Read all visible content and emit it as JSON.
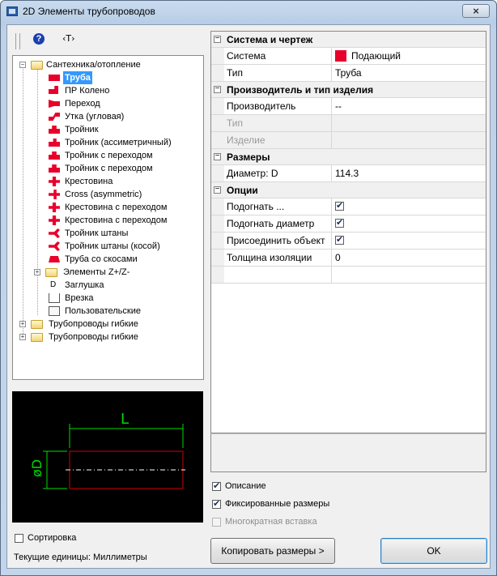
{
  "window": {
    "title": "2D Элементы трубопроводов",
    "close_glyph": "×"
  },
  "toolbar": {
    "help_glyph": "?",
    "t_glyph": "‹T›"
  },
  "tree": {
    "root": "Сантехника/отопление",
    "items": [
      "Труба",
      "ПР Колено",
      "Переход",
      "Утка (угловая)",
      "Тройник",
      "Тройник (ассиметричный)",
      "Тройник с переходом",
      "Тройник с переходом",
      "Крестовина",
      "Cross (asymmetric)",
      "Крестовина с переходом",
      "Крестовина с переходом",
      "Тройник штаны",
      "Тройник штаны (косой)",
      "Труба со скосами"
    ],
    "sub_folder": "Элементы Z+/Z-",
    "extra_items": [
      "Заглушка",
      "Врезка",
      "Пользовательские"
    ],
    "stub_glyph": "D",
    "top_folders": [
      "Трубопроводы гибкие",
      "Трубопроводы гибкие"
    ],
    "plus_glyph": "+",
    "minus_glyph": "−"
  },
  "preview": {
    "length_label": "L",
    "diameter_label": "øD",
    "line_color": "#d40000",
    "dim_color": "#00dd00"
  },
  "properties": {
    "cat_system": "Система и чертеж",
    "system_label": "Система",
    "system_value": "Подающий",
    "system_color": "#e8002a",
    "type_label": "Тип",
    "type_value": "Труба",
    "cat_manufacturer": "Производитель и тип изделия",
    "manufacturer_label": "Производитель",
    "manufacturer_value": "--",
    "type2_label": "Тип",
    "product_label": "Изделие",
    "cat_sizes": "Размеры",
    "diameter_label": "Диаметр: D",
    "diameter_value": "114.3",
    "cat_options": "Опции",
    "fit_label": "Подогнать ...",
    "fit_diameter_label": "Подогнать диаметр",
    "attach_label": "Присоединить объект",
    "insulation_label": "Толщина изоляции",
    "insulation_value": "0"
  },
  "options": {
    "description": "Описание",
    "fixed_sizes": "Фиксированные размеры",
    "multi_insert": "Многократная вставка",
    "sort": "Сортировка"
  },
  "units_text": "Текущие единицы: Миллиметры",
  "buttons": {
    "copy_sizes": "Копировать размеры >",
    "ok": "OK"
  }
}
